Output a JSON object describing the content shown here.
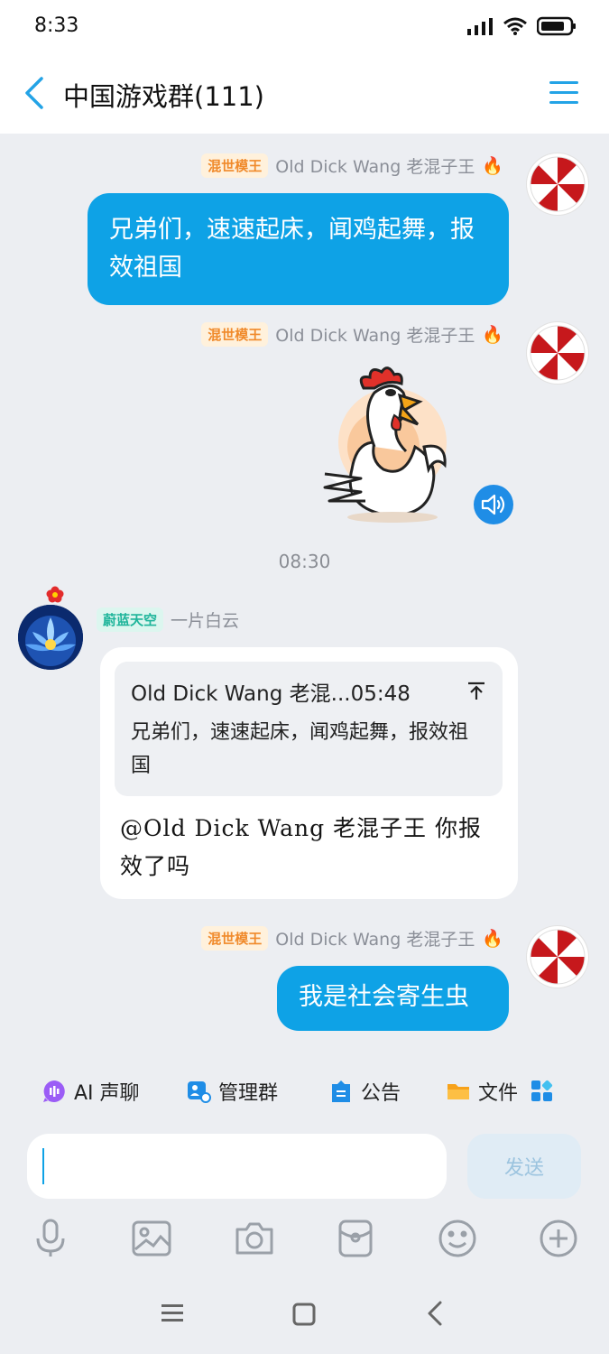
{
  "status_bar": {
    "time": "8:33"
  },
  "header": {
    "title": "中国游戏群(111)"
  },
  "messages": [
    {
      "badge": "混世模王",
      "sender": "Old Dick Wang 老混子王",
      "text": "兄弟们，速速起床，闻鸡起舞，报效祖国"
    },
    {
      "badge": "混世模王",
      "sender": "Old Dick Wang 老混子王",
      "sticker": "rooster-sticker"
    },
    {
      "time": "08:30"
    },
    {
      "badge": "蔚蓝天空",
      "sender": "一片白云",
      "quote_header": "Old Dick Wang 老混...05:48",
      "quote_text": "兄弟们，速速起床，闻鸡起舞，报效祖国",
      "text": "@Old Dick Wang 老混子王 你报效了吗"
    },
    {
      "badge": "混世模王",
      "sender": "Old Dick Wang 老混子王",
      "text": "我是社会寄生虫"
    }
  ],
  "toolbar": {
    "items": [
      {
        "label": "AI 声聊",
        "icon": "ai-voice-icon"
      },
      {
        "label": "管理群",
        "icon": "manage-group-icon"
      },
      {
        "label": "公告",
        "icon": "announcement-icon"
      },
      {
        "label": "文件",
        "icon": "folder-icon"
      }
    ]
  },
  "composer": {
    "send_label": "发送"
  },
  "colors": {
    "accent": "#0ea2e6",
    "bubble_blue": "#0ea2e6",
    "badge_orange": "#f08a2b",
    "badge_teal": "#1fb59b"
  }
}
